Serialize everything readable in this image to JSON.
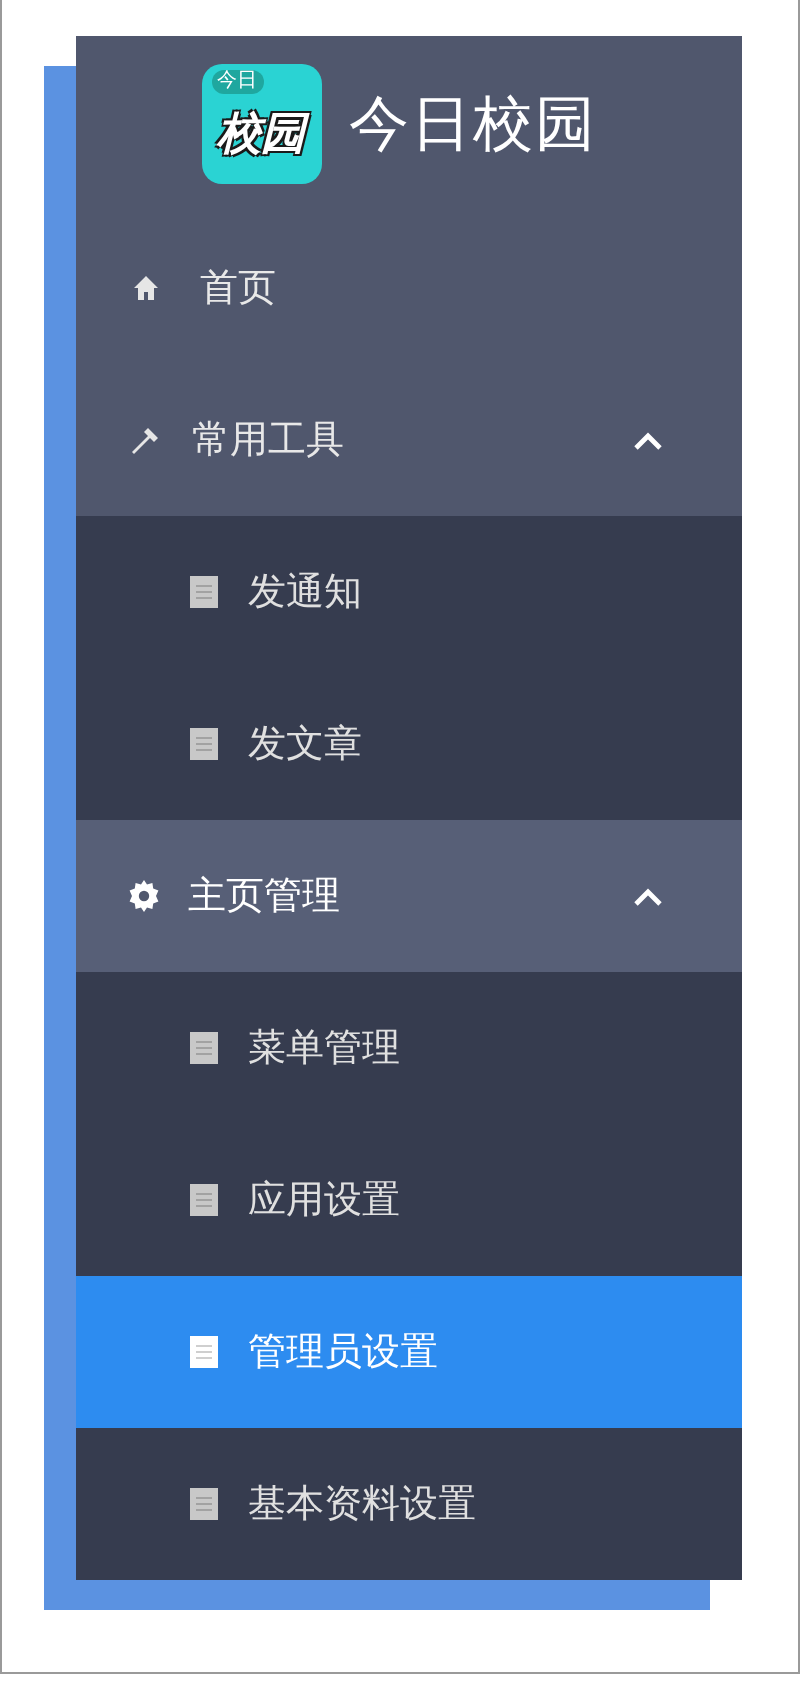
{
  "brand": {
    "badge": "今日",
    "logo_text": "校园",
    "title": "今日校园"
  },
  "menu": [
    {
      "kind": "link",
      "label": "首页"
    },
    {
      "kind": "group",
      "label": "常用工具",
      "expanded": true,
      "active": false,
      "children": [
        {
          "label": "发通知",
          "selected": false
        },
        {
          "label": "发文章",
          "selected": false
        }
      ]
    },
    {
      "kind": "group",
      "label": "主页管理",
      "expanded": true,
      "active": true,
      "children": [
        {
          "label": "菜单管理",
          "selected": false
        },
        {
          "label": "应用设置",
          "selected": false
        },
        {
          "label": "管理员设置",
          "selected": true
        },
        {
          "label": "基本资料设置",
          "selected": false
        }
      ]
    }
  ]
}
